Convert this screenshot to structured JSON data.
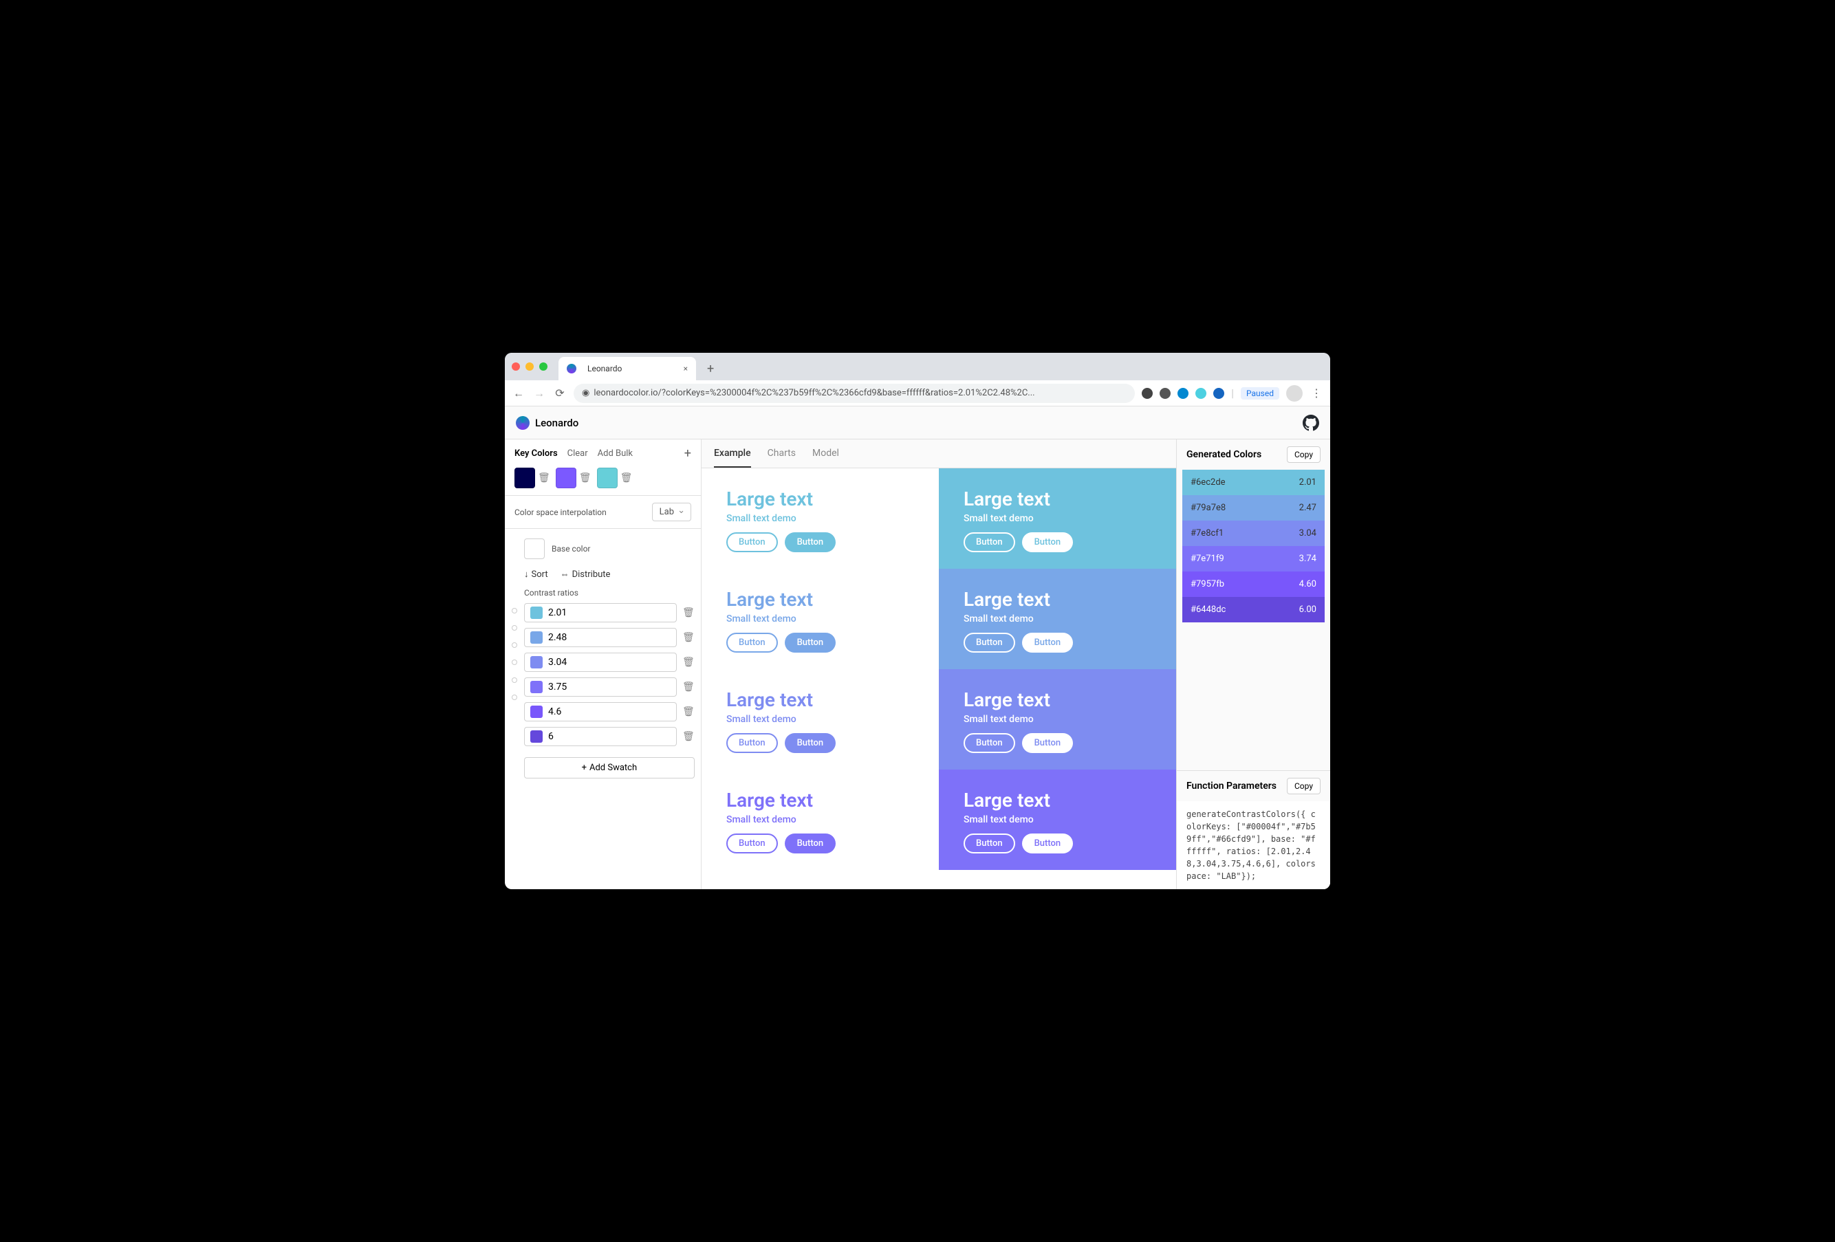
{
  "browser": {
    "tab_title": "Leonardo",
    "url": "leonardocolor.io/?colorKeys=%2300004f%2C%237b59ff%2C%2366cfd9&base=ffffff&ratios=2.01%2C2.48%2C...",
    "paused_label": "Paused"
  },
  "app": {
    "title": "Leonardo"
  },
  "sidebar": {
    "key_colors_label": "Key Colors",
    "clear_label": "Clear",
    "add_bulk_label": "Add Bulk",
    "key_colors": [
      {
        "hex": "#00004f"
      },
      {
        "hex": "#7b59ff"
      },
      {
        "hex": "#66cfd9"
      }
    ],
    "interp_label": "Color space interpolation",
    "interp_value": "Lab",
    "base_label": "Base color",
    "sort_label": "Sort",
    "distribute_label": "Distribute",
    "cr_label": "Contrast ratios",
    "ratios": [
      {
        "val": "2.01",
        "sw": "#6ec2de"
      },
      {
        "val": "2.48",
        "sw": "#79a7e8"
      },
      {
        "val": "3.04",
        "sw": "#7e8cf1"
      },
      {
        "val": "3.75",
        "sw": "#7e71f9"
      },
      {
        "val": "4.6",
        "sw": "#7957fb"
      },
      {
        "val": "6",
        "sw": "#6448dc"
      }
    ],
    "add_swatch_label": "Add Swatch",
    "gradient_css": "linear-gradient(to bottom,#e6f7f7,#8fdde0,#6ec2de,#79a7e8,#7e8cf1,#7e71f9,#7957fb,#6448dc,#3a2a8f,#1a0a4f,#0a0020)"
  },
  "tabs": {
    "items": [
      "Example",
      "Charts",
      "Model"
    ],
    "active": 0
  },
  "demo": {
    "large": "Large text",
    "small": "Small text demo",
    "button": "Button",
    "colors": [
      "#6ec2de",
      "#79a7e8",
      "#7e8cf1",
      "#7e71f9"
    ]
  },
  "generated": {
    "label": "Generated Colors",
    "copy": "Copy",
    "rows": [
      {
        "hex": "#6ec2de",
        "ratio": "2.01",
        "fg": "#333"
      },
      {
        "hex": "#79a7e8",
        "ratio": "2.47",
        "fg": "#333"
      },
      {
        "hex": "#7e8cf1",
        "ratio": "3.04",
        "fg": "#333"
      },
      {
        "hex": "#7e71f9",
        "ratio": "3.74",
        "fg": "#fff"
      },
      {
        "hex": "#7957fb",
        "ratio": "4.60",
        "fg": "#fff"
      },
      {
        "hex": "#6448dc",
        "ratio": "6.00",
        "fg": "#fff"
      }
    ]
  },
  "func": {
    "label": "Function Parameters",
    "copy": "Copy",
    "code": "generateContrastColors({ colorKeys: [\"#00004f\",\"#7b59ff\",\"#66cfd9\"], base: \"#ffffff\", ratios: [2.01,2.48,3.04,3.75,4.6,6], colorspace: \"LAB\"});"
  }
}
